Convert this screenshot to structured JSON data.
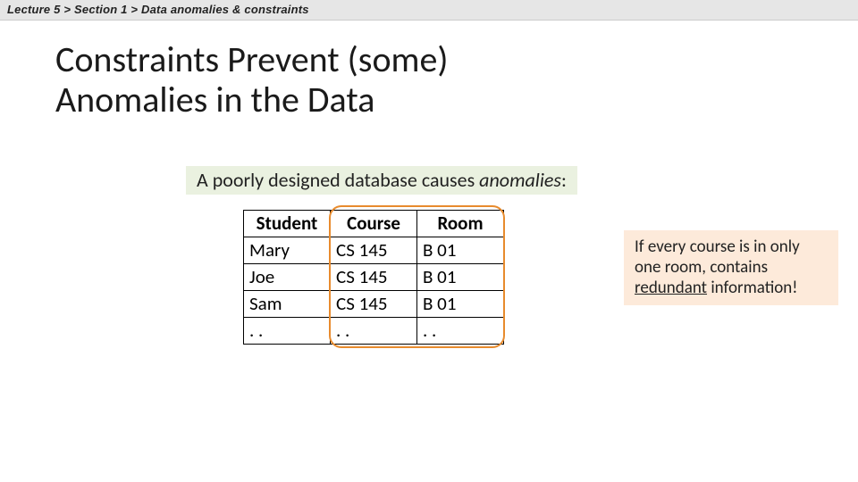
{
  "breadcrumb": "Lecture 5  >  Section 1  >  Data anomalies & constraints",
  "title_line1": "Constraints Prevent (some)",
  "title_line2": "Anomalies in the Data",
  "subtitle_pre": "A poorly designed database causes ",
  "subtitle_em": "anomalies",
  "subtitle_post": ":",
  "headers": {
    "c0": "Student",
    "c1": "Course",
    "c2": "Room"
  },
  "rows": [
    {
      "c0": "Mary",
      "c1": "CS 145",
      "c2": "B 01"
    },
    {
      "c0": "Joe",
      "c1": "CS 145",
      "c2": "B 01"
    },
    {
      "c0": "Sam",
      "c1": "CS 145",
      "c2": "B 01"
    },
    {
      "c0": ". .",
      "c1": ". .",
      "c2": ". ."
    }
  ],
  "callout_pre": "If every course is in only one room, contains ",
  "callout_em": "redundant",
  "callout_post": " information!"
}
